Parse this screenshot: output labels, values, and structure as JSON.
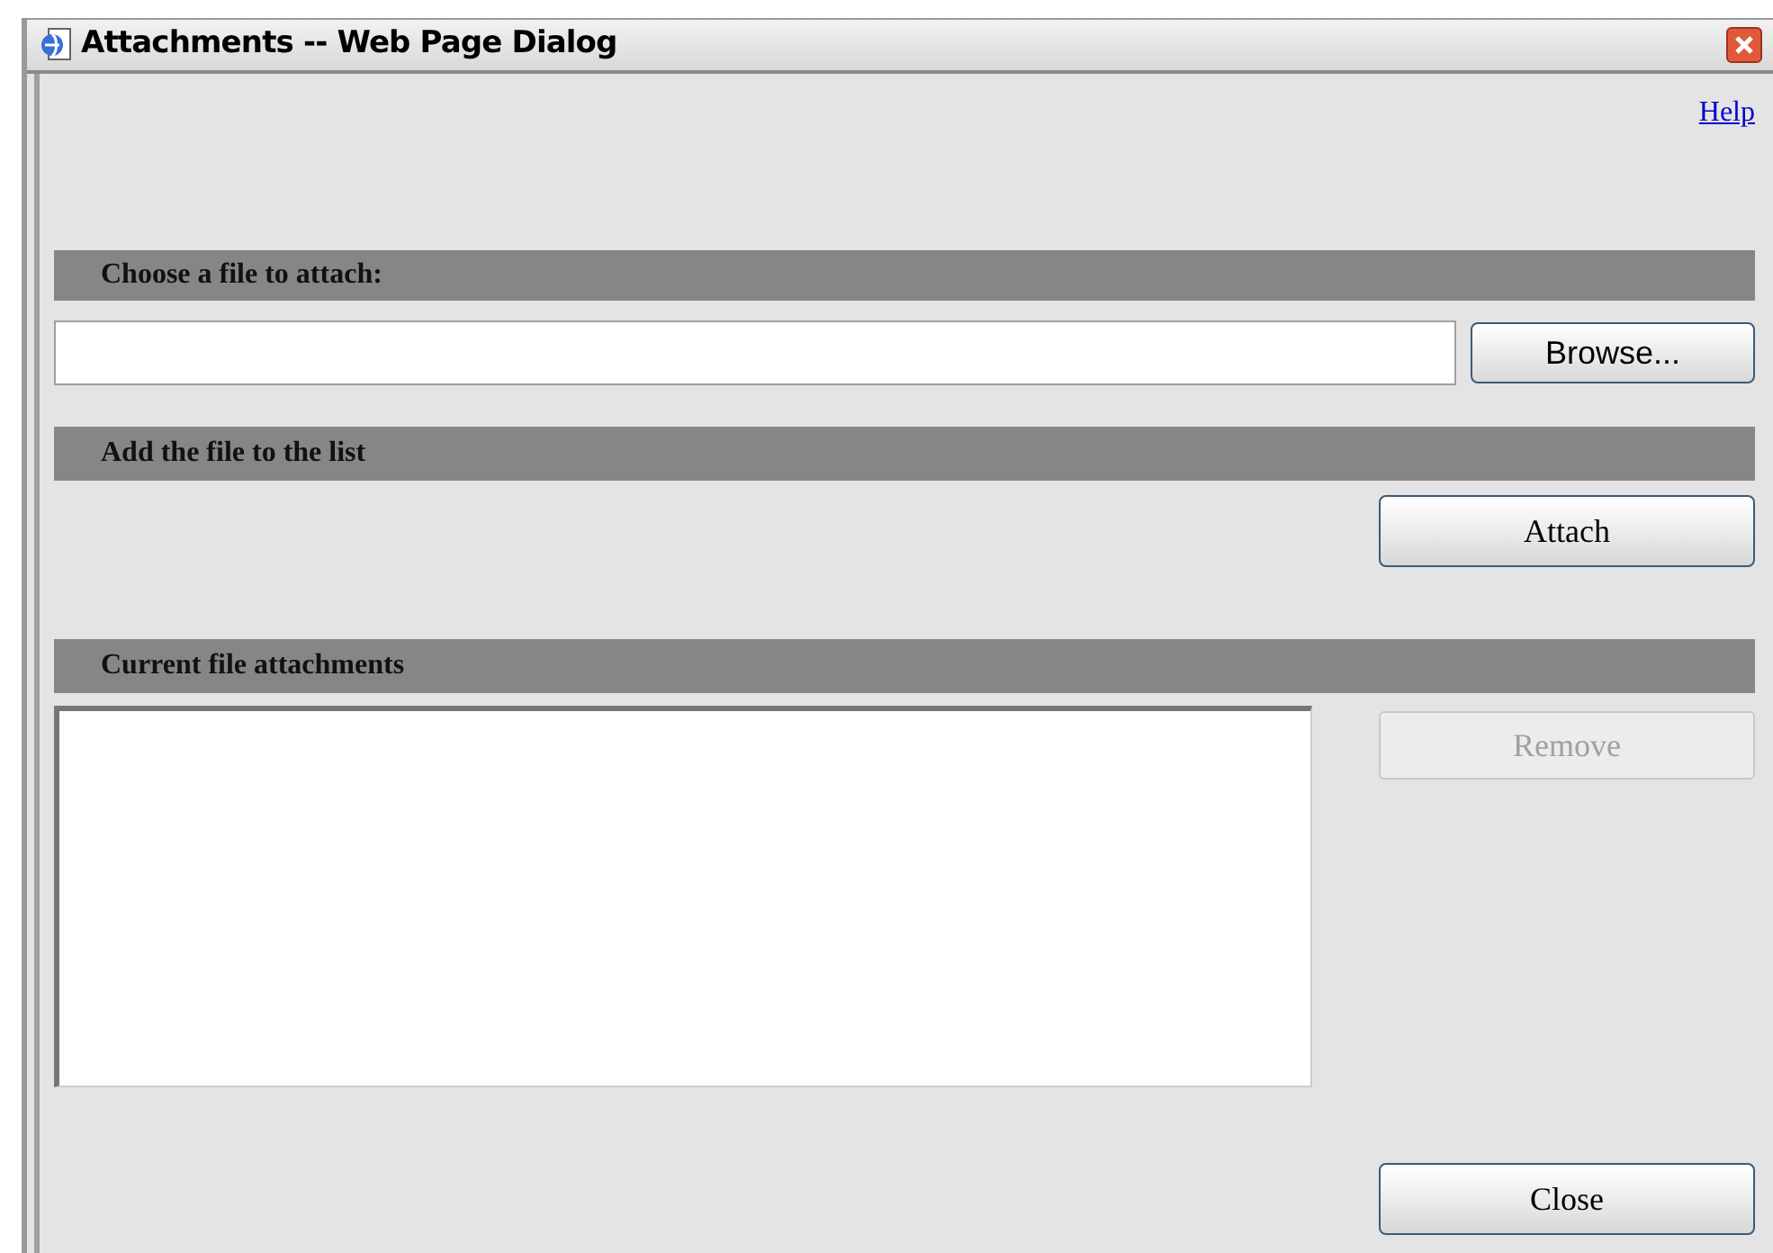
{
  "window": {
    "title": "Attachments -- Web Page Dialog"
  },
  "help_link": "Help",
  "sections": [
    {
      "heading": "Choose a file to attach:"
    },
    {
      "heading": "Add the file to the list"
    },
    {
      "heading": "Current file attachments"
    }
  ],
  "browse_button": {
    "label": "Browse..."
  },
  "attach_button": {
    "label": "Attach"
  },
  "remove_button": {
    "label": "Remove",
    "disabled": true
  },
  "close_button": {
    "label": "Close"
  }
}
